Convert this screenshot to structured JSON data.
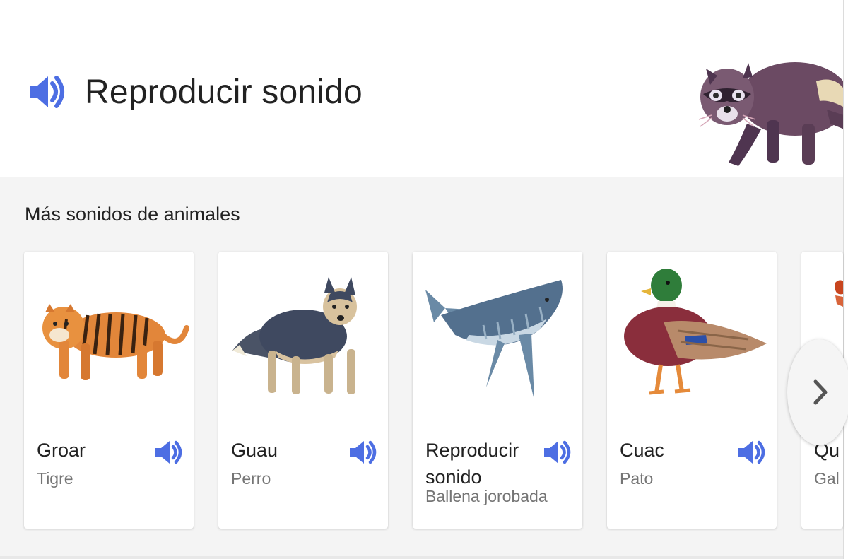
{
  "header": {
    "play_label": "Reproducir sonido",
    "play_icon": "speaker-icon",
    "accent_color": "#4d6ee3"
  },
  "more": {
    "title": "Más sonidos de animales",
    "cards": [
      {
        "sound": "Groar",
        "animal": "Tigre"
      },
      {
        "sound": "Guau",
        "animal": "Perro"
      },
      {
        "sound": "Reproducir sonido",
        "animal": "Ballena jorobada"
      },
      {
        "sound": "Cuac",
        "animal": "Pato"
      },
      {
        "sound": "Qu",
        "animal": "Gal"
      }
    ],
    "next_icon": "chevron-right-icon"
  }
}
